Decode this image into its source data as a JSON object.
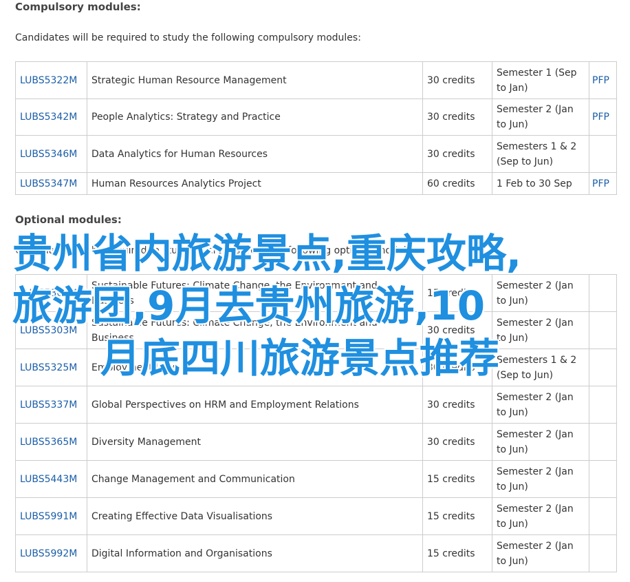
{
  "compulsory": {
    "heading": "Compulsory modules:",
    "intro": "Candidates will be required to study the following compulsory modules:",
    "rows": [
      {
        "code": "LUBS5322M",
        "title": "Strategic Human Resource Management",
        "credits": "30 credits",
        "semester": "Semester 1 (Sep to Jan)",
        "pfp": "PFP"
      },
      {
        "code": "LUBS5342M",
        "title": "People Analytics: Strategy and Practice",
        "credits": "30 credits",
        "semester": "Semester 2 (Jan to Jun)",
        "pfp": "PFP"
      },
      {
        "code": "LUBS5346M",
        "title": "Data Analytics for Human Resources",
        "credits": "30 credits",
        "semester": "Semesters 1 & 2 (Sep to Jun)",
        "pfp": ""
      },
      {
        "code": "LUBS5347M",
        "title": "Human Resources Analytics Project",
        "credits": "60 credits",
        "semester": "1 Feb to 30 Sep",
        "pfp": "PFP"
      }
    ]
  },
  "optional": {
    "heading": "Optional modules:",
    "intro": "Candidates will be required to study 30 credits from the following optional modules:",
    "rows": [
      {
        "code": "LUBS5302M",
        "title": "Sustainable Futures: Climate Change, the Environment and Business",
        "credits": "15 credits",
        "semester": "Semester 2 (Jan to Jun)",
        "pfp": ""
      },
      {
        "code": "LUBS5303M",
        "title": "Sustainable Futures: Climate Change, the Environment and Business",
        "credits": "30 credits",
        "semester": "Semester 2 (Jan to Jun)",
        "pfp": ""
      },
      {
        "code": "LUBS5325M",
        "title": "Employment Law",
        "credits": "30 credits",
        "semester": "Semesters 1 & 2 (Sep to Jun)",
        "pfp": ""
      },
      {
        "code": "LUBS5337M",
        "title": "Global Perspectives on HRM and Employment Relations",
        "credits": "30 credits",
        "semester": "Semester 2 (Jan to Jun)",
        "pfp": ""
      },
      {
        "code": "LUBS5365M",
        "title": "Diversity Management",
        "credits": "30 credits",
        "semester": "Semester 2 (Jan to Jun)",
        "pfp": ""
      },
      {
        "code": "LUBS5443M",
        "title": "Change Management and Communication",
        "credits": "15 credits",
        "semester": "Semester 2 (Jan to Jun)",
        "pfp": ""
      },
      {
        "code": "LUBS5991M",
        "title": "Creating Effective Data Visualisations",
        "credits": "15 credits",
        "semester": "Semester 2 (Jan to Jun)",
        "pfp": ""
      },
      {
        "code": "LUBS5992M",
        "title": "Digital Information and Organisations",
        "credits": "15 credits",
        "semester": "Semester 2 (Jan to Jun)",
        "pfp": ""
      }
    ]
  },
  "overlay": {
    "line1": "贵州省内旅游景点,重庆攻略,",
    "line2": "旅游团,9月去贵州旅游,10",
    "line3": "月底四川旅游景点推荐",
    "color": "#1f8fe0"
  },
  "colors": {
    "link": "#1b5ea8",
    "border": "#cccccc",
    "text": "#333333"
  }
}
